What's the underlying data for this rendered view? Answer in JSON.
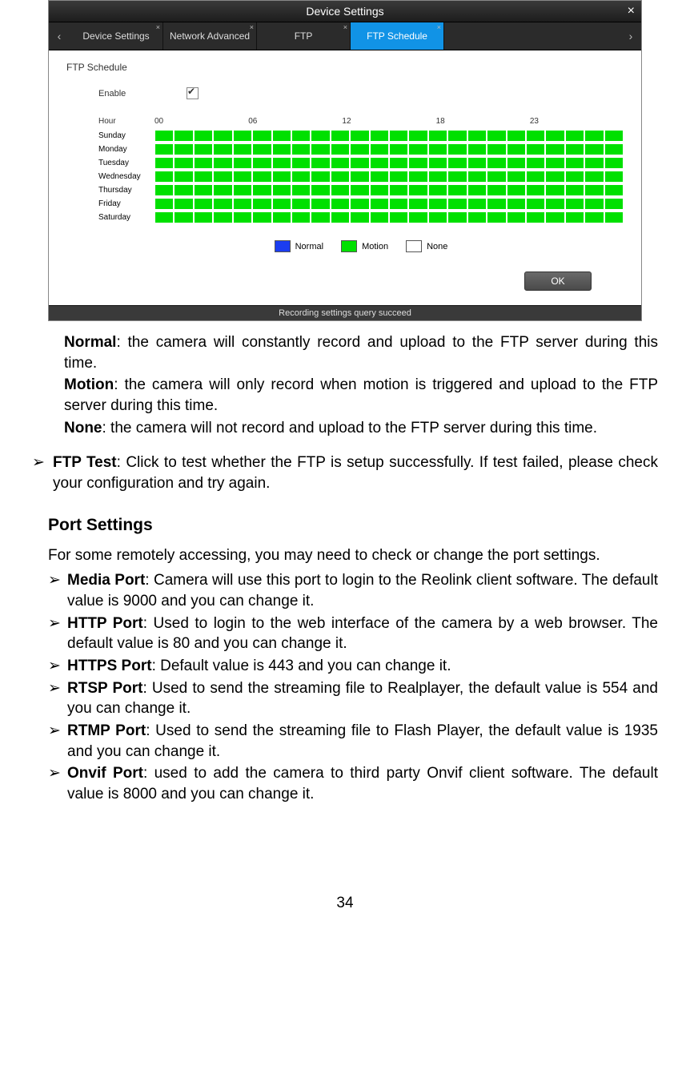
{
  "shot": {
    "title": "Device Settings",
    "tabs": [
      "Device Settings",
      "Network Advanced",
      "FTP",
      "FTP Schedule"
    ],
    "active_tab": "FTP Schedule",
    "panel_title": "FTP Schedule",
    "enable_label": "Enable",
    "enable_checked": true,
    "hour_label": "Hour",
    "hours": [
      "00",
      "06",
      "12",
      "18",
      "23"
    ],
    "days": [
      "Sunday",
      "Monday",
      "Tuesday",
      "Wednesday",
      "Thursday",
      "Friday",
      "Saturday"
    ],
    "cols": 24,
    "legend": {
      "normal": "Normal",
      "motion": "Motion",
      "none": "None"
    },
    "ok": "OK",
    "status": "Recording settings query succeed"
  },
  "desc": {
    "normal_bold": "Normal",
    "normal_rest": ": the camera will constantly record and upload to the FTP server during this time.",
    "motion_bold": "Motion",
    "motion_rest": ": the camera will only record when motion is triggered and upload to the FTP server during this time.",
    "none_bold": "None",
    "none_rest": ": the camera will not record and upload to the FTP server during this time."
  },
  "ftp_test": {
    "mark": "➢",
    "bold": "FTP Test",
    "rest": ": Click to test whether the FTP is setup successfully. If test failed, please check your configuration and try again."
  },
  "port": {
    "heading": "Port Settings",
    "intro": "For some remotely accessing, you may need to check or change the port settings.",
    "items": [
      {
        "mark": "➢",
        "bold": "Media Port",
        "rest": ": Camera will use this port to login to the Reolink client software. The default value is 9000 and you can change it."
      },
      {
        "mark": "➢",
        "bold": "HTTP Port",
        "rest": ": Used to login to the web interface of the camera by a web browser. The default value is 80 and you can change it."
      },
      {
        "mark": "➢",
        "bold": "HTTPS Port",
        "rest": ": Default value is 443 and you can change it."
      },
      {
        "mark": "➢",
        "bold": "RTSP Port",
        "rest": ": Used to send the streaming file to Realplayer, the default value is 554 and you can change it."
      },
      {
        "mark": "➢",
        "bold": "RTMP Port",
        "rest": ": Used to send the streaming file to Flash Player, the default value is 1935 and you can change it."
      },
      {
        "mark": "➢",
        "bold": "Onvif Port",
        "rest": ": used to add the camera to third party Onvif client software. The default value is 8000 and you can change it."
      }
    ]
  },
  "page_number": "34"
}
